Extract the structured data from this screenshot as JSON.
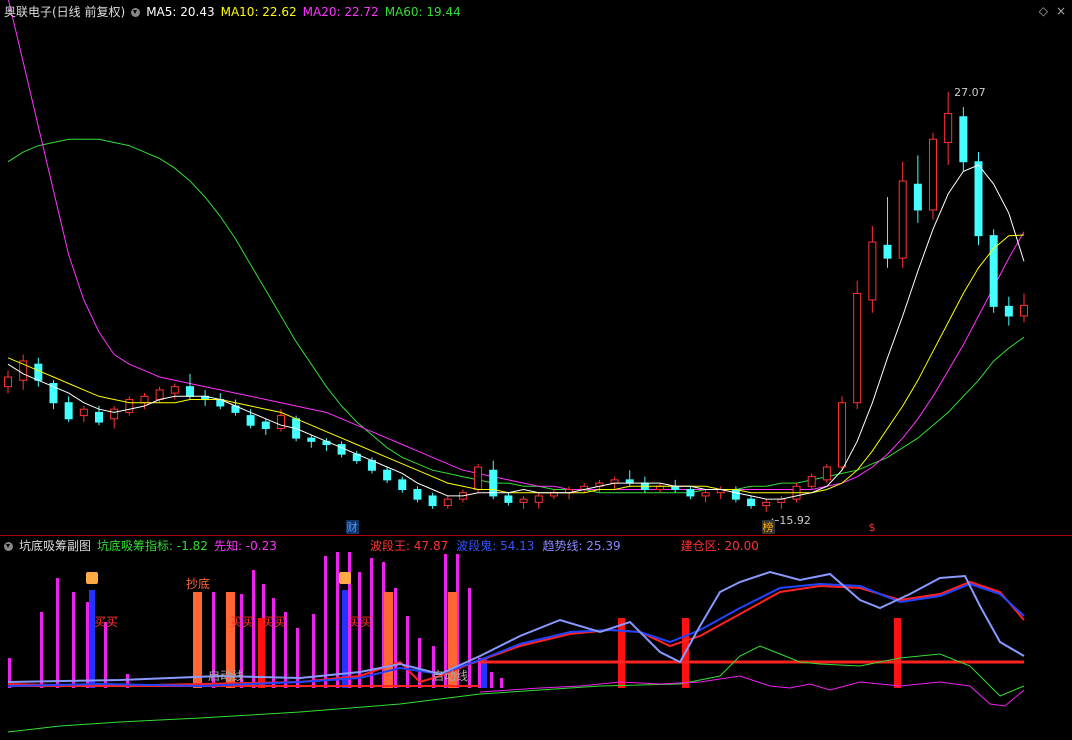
{
  "main": {
    "title": "奥联电子(日线 前复权)",
    "ma": [
      {
        "label": "MA5: 20.43",
        "color": "#ffffff"
      },
      {
        "label": "MA10: 22.62",
        "color": "#ffff00"
      },
      {
        "label": "MA20: 22.72",
        "color": "#ff33ff"
      },
      {
        "label": "MA60: 19.44",
        "color": "#33dd33"
      }
    ],
    "high_label": "27.07",
    "low_label": "15.92",
    "markers": [
      {
        "text": "财",
        "color": "#5599ff",
        "bg": "#113366"
      },
      {
        "text": "榜",
        "color": "#ffaa00",
        "bg": "#333"
      },
      {
        "text": "$",
        "color": "#ff3333",
        "bg": "none"
      }
    ],
    "controls": {
      "diamond": "◇",
      "close": "×"
    }
  },
  "sub": {
    "title": "坑底吸筹副图",
    "items": [
      {
        "label": "坑底吸筹指标: -1.82",
        "color": "#33dd33"
      },
      {
        "label": "先知: -0.23",
        "color": "#ff33ff"
      }
    ],
    "items2": [
      {
        "label": "波段王: 47.87",
        "color": "#ff3333"
      },
      {
        "label": "波段鬼: 54.13",
        "color": "#3355ff"
      },
      {
        "label": "趋势线: 25.39",
        "color": "#8888ff"
      },
      {
        "label": "建仓区: 20.00",
        "color": "#ff3333"
      }
    ],
    "annotations": {
      "chaodi": "抄底",
      "buy": "买买",
      "buy2": "买买",
      "buy3": "买买",
      "buy4": "买买",
      "line1": "启动线",
      "line2": "启动线"
    }
  },
  "chart_data": {
    "type": "candlestick",
    "days": 68,
    "ohlc": [
      [
        17.9,
        18.4,
        17.7,
        18.2
      ],
      [
        18.1,
        18.9,
        17.8,
        18.7
      ],
      [
        18.6,
        18.8,
        17.9,
        18.1
      ],
      [
        18.0,
        18.1,
        17.2,
        17.4
      ],
      [
        17.4,
        17.6,
        16.8,
        16.9
      ],
      [
        17.0,
        17.3,
        16.8,
        17.2
      ],
      [
        17.1,
        17.3,
        16.7,
        16.8
      ],
      [
        16.9,
        17.3,
        16.6,
        17.2
      ],
      [
        17.1,
        17.6,
        17.0,
        17.5
      ],
      [
        17.4,
        17.7,
        17.2,
        17.6
      ],
      [
        17.5,
        17.9,
        17.4,
        17.8
      ],
      [
        17.7,
        18.0,
        17.5,
        17.9
      ],
      [
        17.9,
        18.3,
        17.5,
        17.6
      ],
      [
        17.6,
        17.8,
        17.3,
        17.5
      ],
      [
        17.5,
        17.7,
        17.2,
        17.3
      ],
      [
        17.3,
        17.5,
        17.0,
        17.1
      ],
      [
        17.0,
        17.2,
        16.6,
        16.7
      ],
      [
        16.8,
        16.9,
        16.4,
        16.6
      ],
      [
        16.6,
        17.2,
        16.5,
        17.0
      ],
      [
        16.9,
        17.0,
        16.2,
        16.3
      ],
      [
        16.3,
        16.4,
        16.0,
        16.2
      ],
      [
        16.2,
        16.3,
        15.9,
        16.1
      ],
      [
        16.1,
        16.2,
        15.7,
        15.8
      ],
      [
        15.8,
        15.9,
        15.5,
        15.6
      ],
      [
        15.6,
        15.7,
        15.2,
        15.3
      ],
      [
        15.3,
        15.4,
        14.9,
        15.0
      ],
      [
        15.0,
        15.1,
        14.6,
        14.7
      ],
      [
        14.7,
        14.8,
        14.3,
        14.4
      ],
      [
        14.5,
        14.6,
        14.1,
        14.2
      ],
      [
        14.2,
        14.5,
        14.1,
        14.4
      ],
      [
        14.4,
        14.7,
        14.3,
        14.6
      ],
      [
        14.7,
        15.5,
        14.6,
        15.4
      ],
      [
        15.3,
        15.6,
        14.4,
        14.5
      ],
      [
        14.5,
        14.6,
        14.2,
        14.3
      ],
      [
        14.3,
        14.5,
        14.1,
        14.4
      ],
      [
        14.3,
        14.6,
        14.1,
        14.5
      ],
      [
        14.5,
        14.7,
        14.4,
        14.6
      ],
      [
        14.6,
        14.8,
        14.4,
        14.7
      ],
      [
        14.7,
        14.9,
        14.6,
        14.8
      ],
      [
        14.8,
        15.0,
        14.6,
        14.9
      ],
      [
        14.9,
        15.1,
        14.7,
        15.0
      ],
      [
        15.0,
        15.3,
        14.8,
        14.9
      ],
      [
        14.9,
        15.1,
        14.6,
        14.7
      ],
      [
        14.7,
        14.9,
        14.6,
        14.8
      ],
      [
        14.8,
        15.0,
        14.6,
        14.7
      ],
      [
        14.7,
        14.8,
        14.4,
        14.5
      ],
      [
        14.5,
        14.7,
        14.3,
        14.6
      ],
      [
        14.6,
        14.8,
        14.4,
        14.7
      ],
      [
        14.7,
        14.8,
        14.3,
        14.4
      ],
      [
        14.4,
        14.5,
        14.1,
        14.2
      ],
      [
        14.2,
        14.4,
        14.0,
        14.3
      ],
      [
        14.3,
        14.5,
        14.1,
        14.4
      ],
      [
        14.4,
        14.9,
        14.3,
        14.8
      ],
      [
        14.8,
        15.2,
        14.7,
        15.1
      ],
      [
        15.0,
        15.5,
        14.9,
        15.4
      ],
      [
        15.4,
        17.6,
        15.3,
        17.4
      ],
      [
        17.4,
        21.2,
        17.2,
        20.8
      ],
      [
        20.6,
        22.9,
        20.2,
        22.4
      ],
      [
        22.3,
        23.8,
        21.6,
        21.9
      ],
      [
        21.9,
        24.9,
        21.6,
        24.3
      ],
      [
        24.2,
        25.1,
        23.0,
        23.4
      ],
      [
        23.4,
        25.8,
        23.1,
        25.6
      ],
      [
        25.5,
        27.07,
        24.8,
        26.4
      ],
      [
        26.3,
        26.6,
        24.6,
        24.9
      ],
      [
        24.9,
        25.2,
        22.3,
        22.6
      ],
      [
        22.6,
        22.8,
        20.2,
        20.4
      ],
      [
        20.4,
        20.7,
        19.8,
        20.1
      ],
      [
        20.1,
        20.8,
        19.9,
        20.43
      ]
    ],
    "ma5": [
      18.6,
      18.3,
      18.1,
      17.9,
      17.7,
      17.4,
      17.2,
      17.1,
      17.2,
      17.3,
      17.5,
      17.6,
      17.6,
      17.6,
      17.5,
      17.3,
      17.1,
      16.9,
      16.7,
      16.6,
      16.4,
      16.2,
      16.0,
      15.8,
      15.6,
      15.4,
      15.2,
      14.9,
      14.7,
      14.5,
      14.5,
      14.6,
      14.6,
      14.6,
      14.7,
      14.6,
      14.6,
      14.6,
      14.7,
      14.8,
      14.9,
      14.9,
      14.9,
      14.9,
      14.8,
      14.8,
      14.7,
      14.7,
      14.6,
      14.5,
      14.4,
      14.4,
      14.5,
      14.6,
      14.8,
      15.3,
      16.2,
      17.4,
      18.8,
      20.1,
      21.5,
      22.8,
      23.9,
      24.6,
      24.8,
      24.2,
      23.3,
      21.8
    ],
    "ma10": [
      18.8,
      18.6,
      18.4,
      18.2,
      18.0,
      17.8,
      17.6,
      17.5,
      17.4,
      17.4,
      17.4,
      17.4,
      17.5,
      17.5,
      17.5,
      17.4,
      17.3,
      17.2,
      17.1,
      16.9,
      16.7,
      16.5,
      16.3,
      16.1,
      15.9,
      15.7,
      15.5,
      15.3,
      15.1,
      14.9,
      14.8,
      14.7,
      14.7,
      14.6,
      14.6,
      14.6,
      14.6,
      14.6,
      14.6,
      14.7,
      14.7,
      14.8,
      14.8,
      14.8,
      14.8,
      14.8,
      14.8,
      14.7,
      14.7,
      14.6,
      14.6,
      14.6,
      14.6,
      14.6,
      14.7,
      14.9,
      15.3,
      15.9,
      16.6,
      17.3,
      18.1,
      19.0,
      19.9,
      20.8,
      21.6,
      22.2,
      22.6,
      22.62
    ],
    "ma20": [
      30.0,
      28.0,
      26.0,
      24.0,
      22.0,
      20.6,
      19.6,
      18.9,
      18.6,
      18.4,
      18.2,
      18.1,
      18.0,
      17.9,
      17.8,
      17.7,
      17.6,
      17.5,
      17.4,
      17.3,
      17.2,
      17.1,
      16.9,
      16.7,
      16.5,
      16.3,
      16.1,
      15.9,
      15.7,
      15.5,
      15.3,
      15.2,
      15.1,
      15.0,
      14.9,
      14.8,
      14.8,
      14.7,
      14.7,
      14.7,
      14.7,
      14.7,
      14.7,
      14.7,
      14.7,
      14.7,
      14.7,
      14.7,
      14.7,
      14.7,
      14.7,
      14.7,
      14.7,
      14.7,
      14.8,
      14.9,
      15.1,
      15.4,
      15.8,
      16.3,
      16.9,
      17.6,
      18.4,
      19.2,
      20.1,
      21.0,
      21.9,
      22.72
    ],
    "ma60": [
      24.9,
      25.2,
      25.4,
      25.5,
      25.6,
      25.6,
      25.6,
      25.5,
      25.4,
      25.2,
      25.0,
      24.7,
      24.3,
      23.8,
      23.2,
      22.5,
      21.7,
      20.9,
      20.1,
      19.3,
      18.6,
      17.9,
      17.3,
      16.8,
      16.4,
      16.0,
      15.7,
      15.5,
      15.3,
      15.2,
      15.1,
      15.0,
      14.9,
      14.9,
      14.8,
      14.8,
      14.7,
      14.7,
      14.7,
      14.6,
      14.6,
      14.6,
      14.6,
      14.6,
      14.6,
      14.6,
      14.7,
      14.7,
      14.7,
      14.8,
      14.8,
      14.9,
      14.9,
      15.0,
      15.1,
      15.2,
      15.3,
      15.5,
      15.7,
      16.0,
      16.3,
      16.7,
      17.1,
      17.6,
      18.1,
      18.7,
      19.1,
      19.44
    ],
    "ylim": [
      14.0,
      29.0
    ]
  }
}
